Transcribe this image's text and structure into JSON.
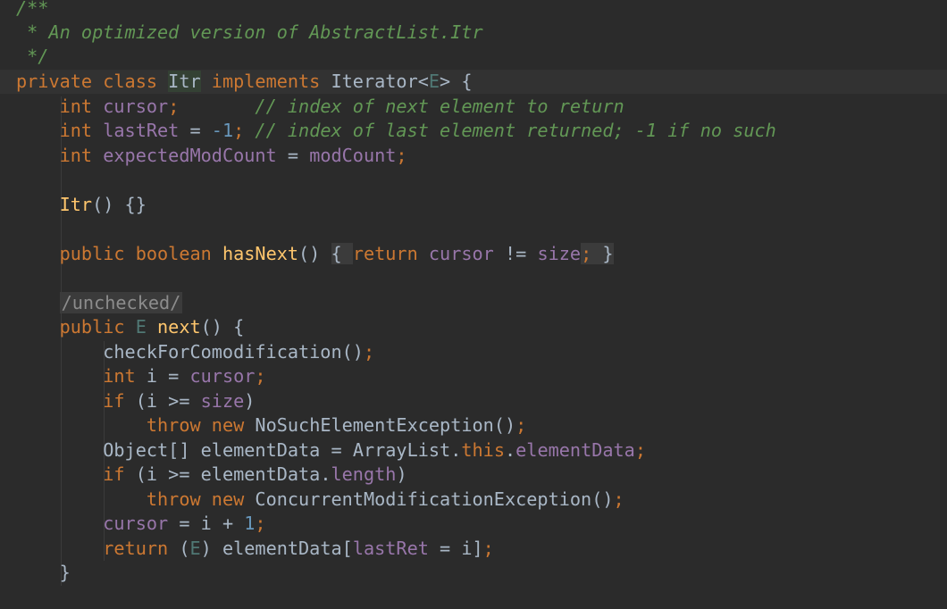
{
  "code": {
    "doc_open": "/**",
    "doc_text": " * An optimized version of AbstractList.Itr",
    "doc_close": " */",
    "kw_private": "private",
    "kw_class": "class",
    "class_name": "Itr",
    "kw_implements": "implements",
    "iface": "Iterator",
    "type_param": "E",
    "kw_int": "int",
    "f_cursor": "cursor",
    "f_lastRet": "lastRet",
    "f_expectedModCount": "expectedModCount",
    "f_modCount": "modCount",
    "f_size": "size",
    "num_neg1": "-1",
    "num_1": "1",
    "cmt_cursor": "// index of next element to return",
    "cmt_lastRet": "// index of last element returned; -1 if no such",
    "kw_public": "public",
    "kw_boolean": "boolean",
    "m_hasNext": "hasNext",
    "kw_return": "return",
    "annotation_unchecked": "/unchecked/",
    "m_next": "next",
    "m_checkForComodification": "checkForComodification",
    "v_i": "i",
    "kw_if": "if",
    "kw_throw": "throw",
    "kw_new": "new",
    "ex_noSuchElement": "NoSuchElementException",
    "ex_concurrentMod": "ConcurrentModificationException",
    "t_object": "Object",
    "v_elementData": "elementData",
    "t_arraylist": "ArrayList",
    "kw_this": "this",
    "f_elementData": "elementData",
    "f_length": "length"
  }
}
